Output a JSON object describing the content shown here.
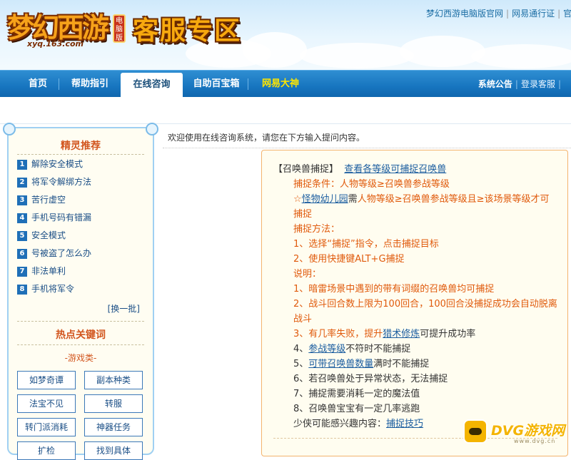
{
  "header": {
    "logo_text": "梦幻西游",
    "logo_badge": "电脑版",
    "logo_url": "xyq.163.com",
    "zone_title": "客服专区",
    "top_links": [
      "梦幻西游电脑版官网",
      "网易通行证",
      "官"
    ]
  },
  "nav": {
    "items": [
      "首页",
      "帮助指引",
      "在线咨询",
      "自助百宝箱",
      "网易大神"
    ],
    "active": "在线咨询",
    "right": {
      "notice": "系统公告",
      "login": "登录客服",
      "trailing": "|"
    }
  },
  "sidebar": {
    "rec_title": "精灵推荐",
    "rec_items": [
      {
        "num": "1",
        "label": "解除安全模式"
      },
      {
        "num": "2",
        "label": "将军令解绑方法"
      },
      {
        "num": "3",
        "label": "苦行虚空"
      },
      {
        "num": "4",
        "label": "手机号码有错漏"
      },
      {
        "num": "5",
        "label": "安全模式"
      },
      {
        "num": "6",
        "label": "号被盗了怎么办"
      },
      {
        "num": "7",
        "label": "非法单利"
      },
      {
        "num": "8",
        "label": "手机将军令"
      }
    ],
    "more": "[换一批]",
    "hot_title": "热点关键词",
    "category": "-游戏类-",
    "keywords": [
      "如梦奇谭",
      "副本种类",
      "法宝不见",
      "转服",
      "转门派消耗",
      "神器任务",
      "扩检",
      "找到具体"
    ]
  },
  "main": {
    "welcome": "欢迎使用在线咨询系统，请您在下方输入提问内容。",
    "answer": {
      "head_bracket": "【召唤兽捕捉】",
      "head_link": "查看各等级可捕捉召唤兽",
      "condition": "捕捉条件：人物等级≥召唤兽参战等级",
      "star_mark": "☆",
      "star_link": "怪物幼儿园",
      "star_tail_dark": "需",
      "star_tail": "人物等级≥召唤兽参战等级且≥该场景等级才可捕捉",
      "method_title": "捕捉方法：",
      "method_1": "1、选择“捕捉”指令，点击捕捉目标",
      "method_2": "2、使用快捷键ALT+G捕捉",
      "note_title": "说明：",
      "note_1": "1、暗雷场景中遇到的带有词缀的召唤兽均可捕捉",
      "note_2": "2、战斗回合数上限为100回合，100回合没捕捉成功会自动脱离战斗",
      "note_3_pre": "3、有几率失败，提升",
      "note_3_link": "猎术修炼",
      "note_3_post": "可提升成功率",
      "note_4_pre": "4、",
      "note_4_link": "参战等级",
      "note_4_post": "不符时不能捕捉",
      "note_5_pre": "5、",
      "note_5_link": "可带召唤兽数量",
      "note_5_post": "满时不能捕捉",
      "note_6": "6、若召唤兽处于异常状态，无法捕捉",
      "note_7": "7、捕捉需要消耗一定的魔法值",
      "note_8": "8、召唤兽宝宝有一定几率逃跑",
      "interest_pre": "少侠可能感兴趣内容：",
      "interest_link": "捕捉技巧"
    }
  },
  "watermark": {
    "text": "DVG游戏网",
    "sub": "www.dvg.cn"
  },
  "colors": {
    "nav_blue": "#1775bf",
    "orange_text": "#e05a0c",
    "link_blue": "#1c5ea0",
    "title_gold": "#f7a90e"
  }
}
